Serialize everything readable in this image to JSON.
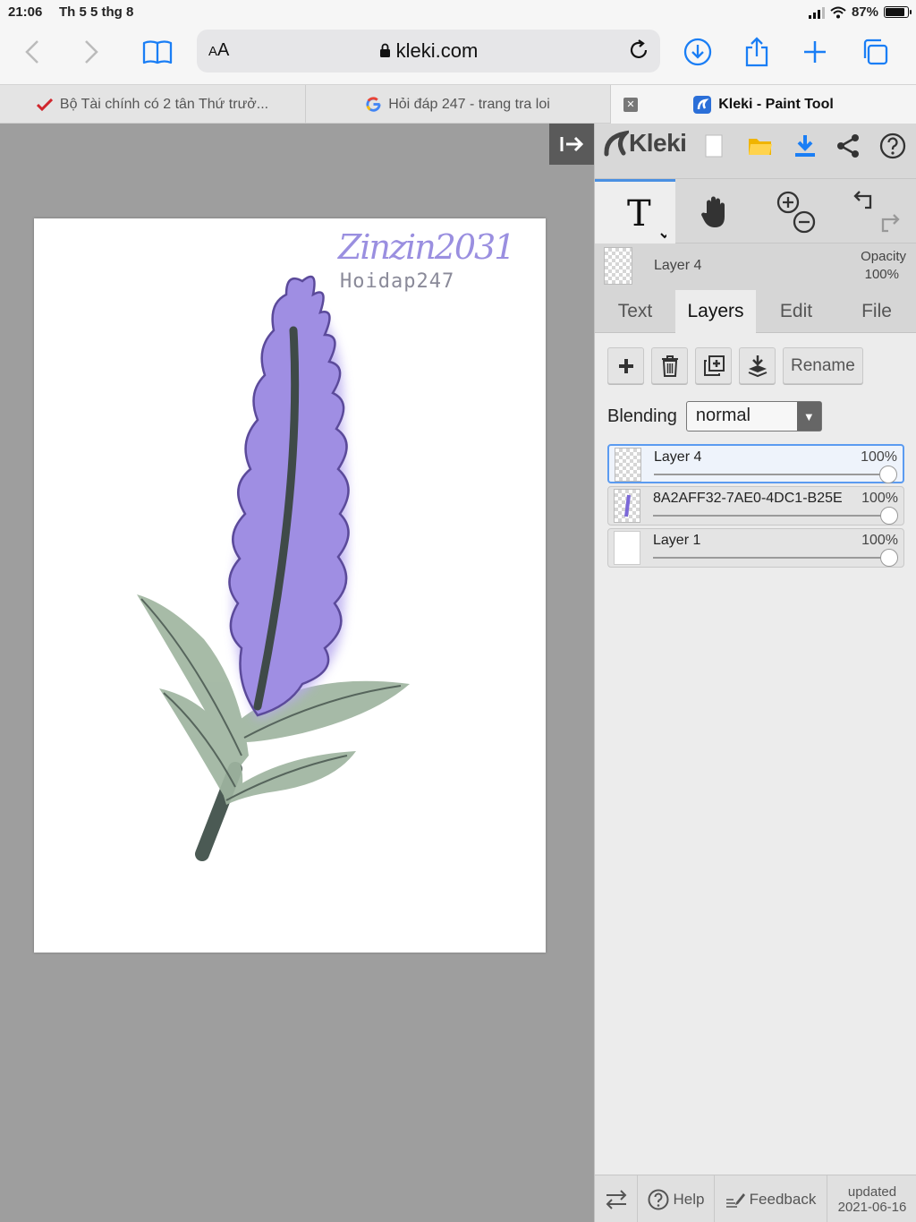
{
  "status": {
    "time": "21:06",
    "date": "Th 5 5 thg 8",
    "battery": "87%",
    "battery_level": 0.87
  },
  "browser": {
    "aa_small": "A",
    "aa_large": "A",
    "url": "kleki.com",
    "tabs": [
      {
        "title": "Bộ Tài chính có 2 tân Thứ trưở...",
        "active": false
      },
      {
        "title": "Hỏi đáp 247 - trang tra loi",
        "active": false
      },
      {
        "title": "Kleki - Paint Tool",
        "active": true
      }
    ],
    "accent": "#1a7ef5"
  },
  "canvas": {
    "watermark_signature": "Zinzin2031",
    "watermark_site": "Hoidap247"
  },
  "panel": {
    "logo": "Kleki",
    "layer_preview": {
      "name": "Layer 4",
      "opacity_label": "Opacity",
      "opacity_value": "100%"
    },
    "tabs": [
      "Text",
      "Layers",
      "Edit",
      "File"
    ],
    "active_tab": "Layers",
    "rename_label": "Rename",
    "blending_label": "Blending",
    "blending_value": "normal",
    "layers": [
      {
        "name": "Layer 4",
        "opacity": "100%",
        "selected": true
      },
      {
        "name": "8A2AFF32-7AE0-4DC1-B25E",
        "opacity": "100%",
        "selected": false
      },
      {
        "name": "Layer 1",
        "opacity": "100%",
        "selected": false
      }
    ],
    "footer": {
      "help": "Help",
      "feedback": "Feedback",
      "updated_label": "updated",
      "updated_date": "2021-06-16"
    }
  },
  "colors": {
    "flower": "#9f8ee3",
    "leaf": "#9fb5a0",
    "stem": "#3f4a48",
    "selection": "#5b9bf0"
  }
}
